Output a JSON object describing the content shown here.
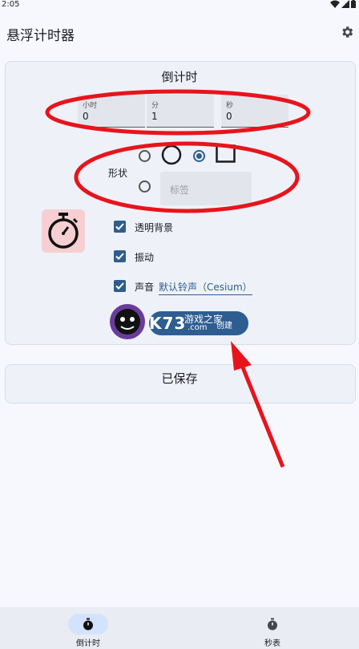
{
  "status_bar": {
    "time": "2:05"
  },
  "app": {
    "title": "悬浮计时器"
  },
  "countdown_card": {
    "title": "倒计时",
    "fields": [
      {
        "label": "小时",
        "value": "0"
      },
      {
        "label": "分",
        "value": "1"
      },
      {
        "label": "秒",
        "value": "0"
      }
    ],
    "shape": {
      "label": "形状",
      "options": [
        {
          "kind": "circle",
          "selected": false
        },
        {
          "kind": "square",
          "selected": true
        },
        {
          "kind": "tag",
          "selected": false
        }
      ],
      "tag_placeholder": "标签"
    },
    "options": [
      {
        "label": "透明背景",
        "checked": true
      },
      {
        "label": "振动",
        "checked": true
      },
      {
        "label": "声音",
        "checked": true,
        "value": "默认铃声（Cesium）"
      }
    ],
    "create_button": "创建"
  },
  "saved_card": {
    "title": "已保存"
  },
  "watermark": {
    "brand": "K73",
    "text": "游戏之家",
    "sub": ".com"
  },
  "bottom_nav": {
    "items": [
      {
        "label": "倒计时",
        "icon": "stopwatch-icon",
        "active": true
      },
      {
        "label": "秒表",
        "icon": "stopwatch-icon",
        "active": false
      }
    ]
  },
  "colors": {
    "accent": "#2e5d91",
    "annotation": "#e8141c",
    "timer_icon_bg": "#f6cfd2",
    "nav_active_bg": "#d3e3fd"
  }
}
